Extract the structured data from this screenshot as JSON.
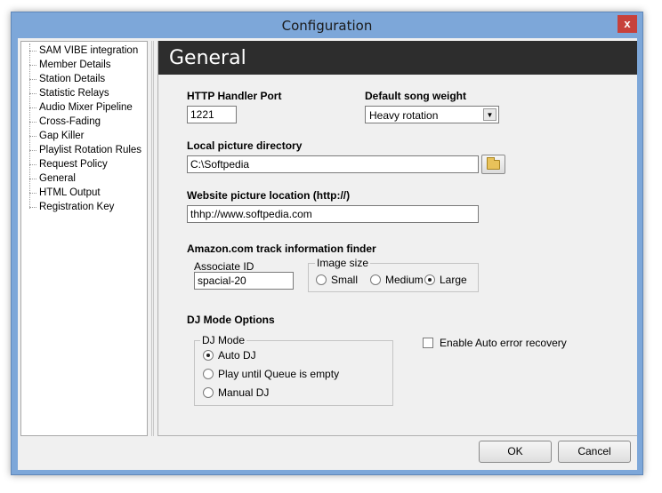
{
  "window": {
    "title": "Configuration",
    "close_glyph": "x"
  },
  "sidebar": {
    "items": [
      {
        "label": "SAM VIBE integration"
      },
      {
        "label": "Member Details"
      },
      {
        "label": "Station Details"
      },
      {
        "label": "Statistic Relays"
      },
      {
        "label": "Audio Mixer Pipeline"
      },
      {
        "label": "Cross-Fading"
      },
      {
        "label": "Gap Killer"
      },
      {
        "label": "Playlist Rotation Rules"
      },
      {
        "label": "Request Policy"
      },
      {
        "label": "General"
      },
      {
        "label": "HTML Output"
      },
      {
        "label": "Registration Key"
      }
    ]
  },
  "panel": {
    "title": "General",
    "http_port": {
      "label": "HTTP Handler Port",
      "value": "1221"
    },
    "song_weight": {
      "label": "Default song weight",
      "value": "Heavy rotation"
    },
    "picture_dir": {
      "label": "Local picture directory",
      "value": "C:\\Softpedia"
    },
    "website_location": {
      "label": "Website picture location (http://)",
      "value": "thhp://www.softpedia.com"
    },
    "amazon": {
      "label": "Amazon.com track information finder",
      "associate_label": "Associate ID",
      "associate_value": "spacial-20",
      "image_size_label": "Image size",
      "sizes": [
        "Small",
        "Medium",
        "Large"
      ],
      "selected_size": "Large"
    },
    "dj": {
      "section_label": "DJ Mode Options",
      "group_label": "DJ Mode",
      "modes": [
        "Auto DJ",
        "Play until Queue is empty",
        "Manual DJ"
      ],
      "selected_mode": "Auto DJ",
      "auto_recovery_label": "Enable Auto error recovery",
      "auto_recovery_checked": false
    }
  },
  "footer": {
    "ok_label": "OK",
    "cancel_label": "Cancel"
  },
  "icons": {
    "close": "close-icon",
    "dropdown": "chevron-down-icon",
    "browse": "folder-icon"
  },
  "colors": {
    "frame": "#7da7d9",
    "header_bg": "#2d2d2d",
    "close": "#c7413b"
  }
}
